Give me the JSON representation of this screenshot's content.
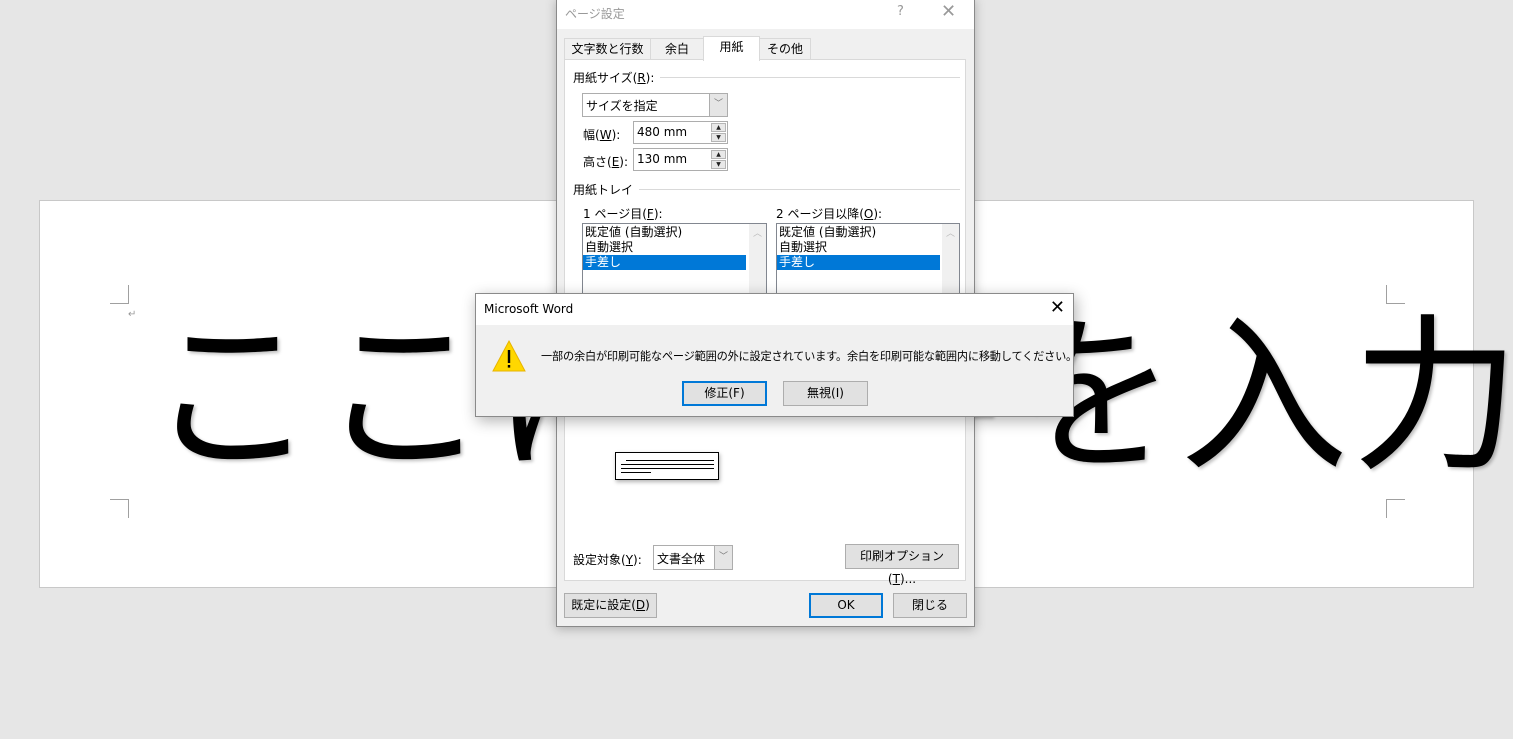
{
  "document": {
    "text": "ここに文字を入力",
    "paragraph_mark": "↵"
  },
  "page_setup": {
    "title": "ページ設定",
    "help_label": "?",
    "close_label": "✕",
    "tabs": [
      {
        "label": "文字数と行数",
        "active": false
      },
      {
        "label": "余白",
        "active": false
      },
      {
        "label": "用紙",
        "active": true
      },
      {
        "label": "その他",
        "active": false
      }
    ],
    "paper_size": {
      "group_label": "用紙サイズ(",
      "group_key": "R",
      "group_suffix": "):",
      "selected": "サイズを指定",
      "width_label": "幅(",
      "width_key": "W",
      "width_suffix": "):",
      "width_value": "480 mm",
      "height_label": "高さ(",
      "height_key": "E",
      "height_suffix": "):",
      "height_value": "130 mm"
    },
    "paper_tray": {
      "group_label": "用紙トレイ",
      "first_page_label": "1 ページ目(",
      "first_page_key": "F",
      "first_page_suffix": "):",
      "other_pages_label": "2 ページ目以降(",
      "other_pages_key": "O",
      "other_pages_suffix": "):",
      "first_page_options": [
        "既定値 (自動選択)",
        "自動選択",
        "手差し"
      ],
      "first_page_selected": "手差し",
      "other_pages_options": [
        "既定値 (自動選択)",
        "自動選択",
        "手差し"
      ],
      "other_pages_selected": "手差し"
    },
    "apply_to": {
      "label": "設定対象(",
      "key": "Y",
      "suffix": "):",
      "selected": "文書全体"
    },
    "print_options_label": "印刷オプション(",
    "print_options_key": "T",
    "print_options_suffix": ")...",
    "set_default_label": "既定に設定(",
    "set_default_key": "D",
    "set_default_suffix": ")",
    "ok_label": "OK",
    "close_button_label": "閉じる"
  },
  "alert": {
    "title": "Microsoft Word",
    "close_label": "✕",
    "message": "一部の余白が印刷可能なページ範囲の外に設定されています。余白を印刷可能な範囲内に移動してください。",
    "fix_label": "修正(F)",
    "ignore_label": "無視(I)",
    "icon": "warning-icon",
    "icon_color": "#ffd700"
  }
}
